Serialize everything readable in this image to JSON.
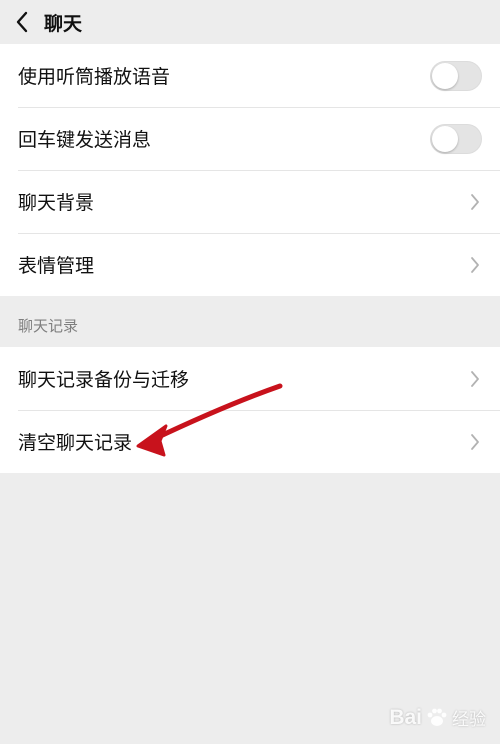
{
  "header": {
    "title": "聊天"
  },
  "settings": {
    "items": [
      {
        "label": "使用听筒播放语音",
        "control": "toggle",
        "on": false
      },
      {
        "label": "回车键发送消息",
        "control": "toggle",
        "on": false
      },
      {
        "label": "聊天背景",
        "control": "chevron"
      },
      {
        "label": "表情管理",
        "control": "chevron"
      }
    ]
  },
  "chat_records": {
    "section_title": "聊天记录",
    "items": [
      {
        "label": "聊天记录备份与迁移",
        "control": "chevron"
      },
      {
        "label": "清空聊天记录",
        "control": "chevron"
      }
    ]
  },
  "annotation": {
    "arrow_color": "#c8121c"
  },
  "watermark": {
    "brand": "Bai",
    "brand_suffix": "经验"
  },
  "colors": {
    "background": "#ededed",
    "card": "#ffffff",
    "toggle_off": "#e4e4e4"
  }
}
